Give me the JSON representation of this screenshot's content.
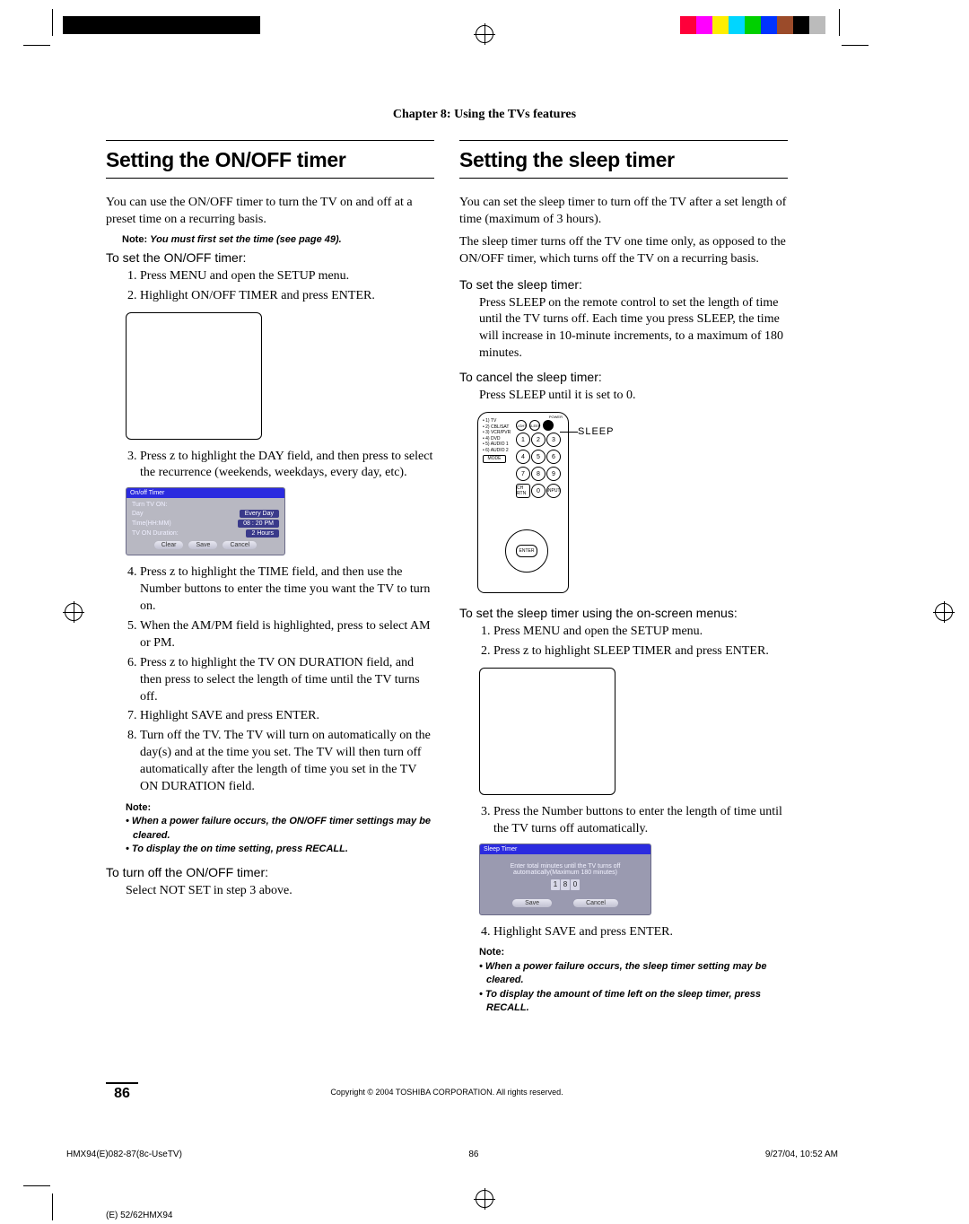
{
  "printer_bar": {
    "swatches": [
      "#ff003a",
      "#ff00ff",
      "#ffee00",
      "#00d6ff",
      "#00d000",
      "#0033ff",
      "#9b4b2a",
      "#000000",
      "#888888"
    ]
  },
  "chapter_header": "Chapter 8: Using the TVs features",
  "left": {
    "heading": "Setting the ON/OFF timer",
    "intro": "You can use the ON/OFF timer to turn the TV on and off at a preset time on a recurring basis.",
    "note1_label": "Note:",
    "note1_text": "You must first set the time (see page 49).",
    "to_set": "To set the ON/OFF timer:",
    "steps": [
      "Press MENU and open the SETUP menu.",
      "Highlight ON/OFF TIMER and press ENTER."
    ],
    "step3": "Press z  to highlight the DAY field, and then press     to select the recurrence (weekends, weekdays, every day, etc).",
    "onoff_ui": {
      "title": "On/off Timer",
      "turn_on": "Turn TV ON:",
      "day_label": "Day",
      "day_value": "Every Day",
      "time_label": "Time(HH:MM)",
      "time_value": "08 : 20  PM",
      "duration_label": "TV ON Duration:",
      "duration_value": "2 Hours",
      "btn_clear": "Clear",
      "btn_save": "Save",
      "btn_cancel": "Cancel"
    },
    "steps2": [
      "Press z  to highlight the TIME field, and then use the Number buttons to enter the time you want the TV to turn on.",
      "When the AM/PM field is highlighted, press     to select AM or PM.",
      "Press z  to highlight the TV ON DURATION field, and then press     to select the length of time until the TV turns off.",
      "Highlight SAVE and press ENTER.",
      "Turn off the TV. The TV will turn on automatically on the day(s) and at the time you set. The TV will then turn off automatically after the length of time you set in the TV ON DURATION field."
    ],
    "note2_label": "Note:",
    "note2_bullets": [
      "• When a power failure occurs, the ON/OFF timer settings may be cleared.",
      "• To display the on time setting, press RECALL."
    ],
    "turn_off": "To turn off the ON/OFF timer:",
    "turn_off_step": "Select NOT SET in step 3 above."
  },
  "right": {
    "heading": "Setting the sleep timer",
    "intro1": "You can set the sleep timer to turn off the TV after a set length of time (maximum of 3 hours).",
    "intro2": "The sleep timer turns off the TV one time only, as opposed to the ON/OFF timer, which turns off the TV on a recurring basis.",
    "to_set": "To set the sleep timer:",
    "set_body": "Press SLEEP on the remote control to set the length of time until the TV turns off. Each time you press SLEEP, the time will increase in 10-minute increments, to a maximum of 180 minutes.",
    "to_cancel": "To cancel the sleep timer:",
    "cancel_body": "Press SLEEP until it is set to 0.",
    "remote": {
      "devices": [
        "• 1) TV",
        "• 2) CBL/SAT",
        "• 3) VCR/PVR",
        "• 4) DVD",
        "• 5) AUDIO 1",
        "• 6) AUDIO 2"
      ],
      "power_label": "POWER",
      "small_btns": [
        "LIGHT",
        "SLEEP"
      ],
      "enter": "ENTER",
      "sleep_callout": "SLEEP"
    },
    "to_set_menus": "To set the sleep timer using the on-screen menus:",
    "menus_steps": [
      "Press MENU and open the SETUP menu.",
      "Press z  to highlight SLEEP TIMER and press ENTER."
    ],
    "step3": "Press the Number buttons to enter the length of time until the TV turns off automatically.",
    "sleep_ui": {
      "title": "Sleep Timer",
      "msg1": "Enter total minutes until the TV turns off",
      "msg2": "automatically(Maximum 180 minutes)",
      "digits": [
        "1",
        "8",
        "0"
      ],
      "btn_save": "Save",
      "btn_cancel": "Cancel"
    },
    "step4": "Highlight SAVE and press ENTER.",
    "note_label": "Note:",
    "note_bullets": [
      "• When a power failure occurs, the sleep timer setting may be cleared.",
      "• To display the amount of time left on the sleep timer, press RECALL."
    ]
  },
  "footer": {
    "page": "86",
    "copyright": "Copyright © 2004 TOSHIBA CORPORATION. All rights reserved.",
    "file": "HMX94(E)082-87(8c-UseTV)",
    "pg2": "86",
    "timestamp": "9/27/04, 10:52 AM",
    "slug": "(E) 52/62HMX94"
  }
}
